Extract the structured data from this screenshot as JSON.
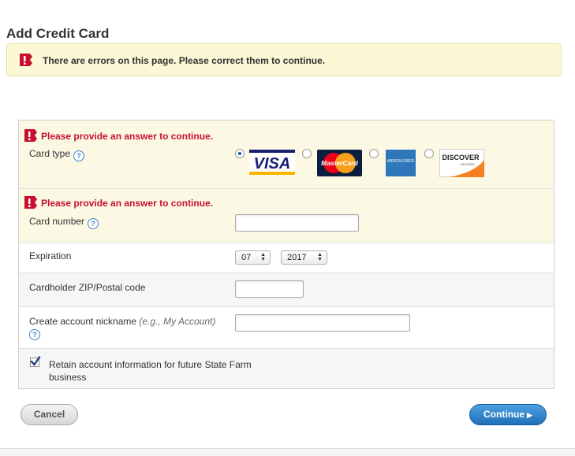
{
  "page": {
    "title": "Add Credit Card"
  },
  "banner": {
    "message": "There are errors on this page. Please correct them to continue."
  },
  "card_type": {
    "error": "Please provide an answer to continue.",
    "label": "Card type",
    "help": "?",
    "options": [
      {
        "name": "VISA",
        "selected": true
      },
      {
        "name": "MasterCard",
        "selected": false
      },
      {
        "name": "AMERICAN EXPRESS",
        "selected": false
      },
      {
        "name": "DISCOVER",
        "sub": "NETWORK",
        "selected": false
      }
    ]
  },
  "card_number": {
    "error": "Please provide an answer to continue.",
    "label": "Card number",
    "help": "?",
    "value": ""
  },
  "expiration": {
    "label": "Expiration",
    "month": "07",
    "year": "2017"
  },
  "zip": {
    "label": "Cardholder ZIP/Postal code",
    "value": ""
  },
  "nickname": {
    "label": "Create account nickname",
    "hint": "(e.g., My Account)",
    "help": "?",
    "value": ""
  },
  "retain": {
    "label_line1": "Retain account information for future State Farm",
    "label_line2": "business",
    "checked": true
  },
  "buttons": {
    "cancel": "Cancel",
    "continue": "Continue"
  },
  "colors": {
    "error_red": "#c8102e",
    "banner_bg": "#fbf8d6",
    "accent_blue": "#1e6fb8"
  }
}
